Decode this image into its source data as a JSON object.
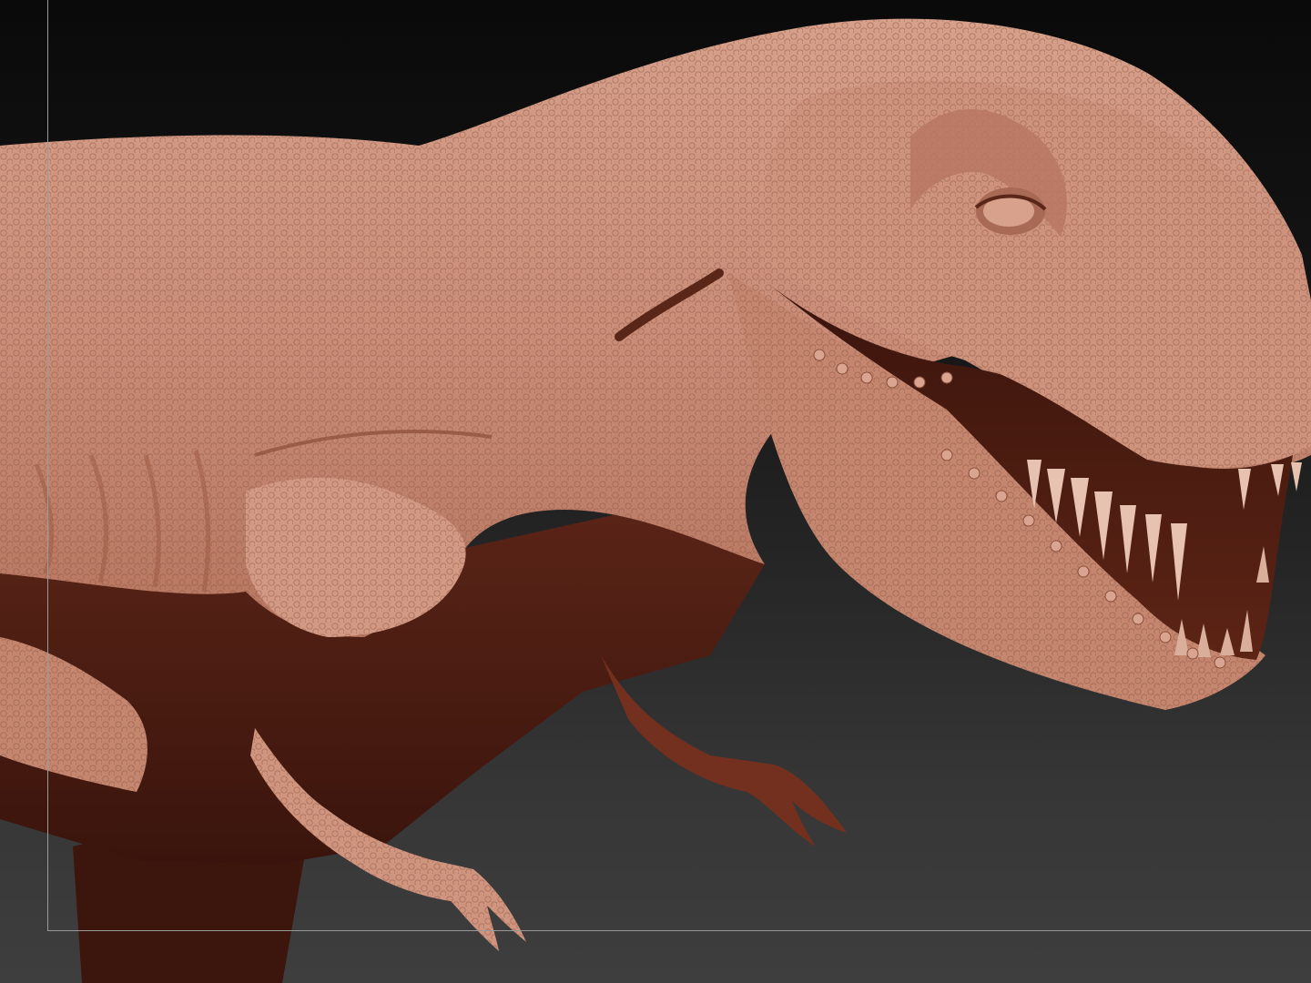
{
  "viewport": {
    "subject_icon": "trex-sculpt-icon",
    "background_top": "#0a0a0a",
    "background_bottom": "#3e3e3e",
    "material_light": "#c98d78",
    "material_mid": "#a56650",
    "material_shadow": "#4a1d12",
    "frame_guide_color": "#9a9a9a"
  }
}
